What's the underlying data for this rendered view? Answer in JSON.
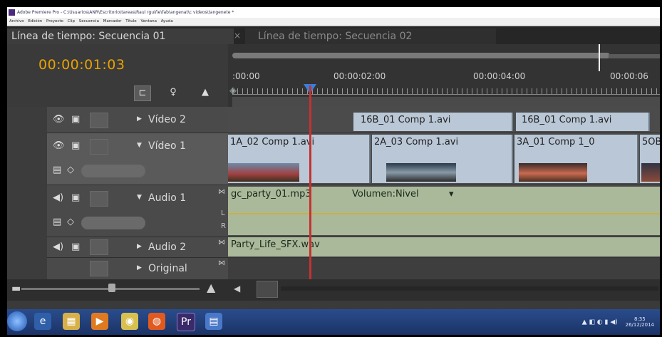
{
  "window": {
    "title": "Adobe Premiere Pro - C:\\Usuarios\\ANR\\Escritorio\\tareas\\Raul rguiñe\\fab\\angenat\\c videos\\tangenete *"
  },
  "menu": [
    "Archivo",
    "Edición",
    "Proyecto",
    "Clip",
    "Secuencia",
    "Marcador",
    "Título",
    "Ventana",
    "Ayuda"
  ],
  "tabs": {
    "active": "Línea de tiempo: Secuencia 01",
    "inactive": "Línea de tiempo: Secuencia 02",
    "close_glyph": "×"
  },
  "timeline": {
    "timecode": "00:00:01:03",
    "ruler_labels": [
      ":00:00",
      "00:00:02:00",
      "00:00:04:00",
      "00:00:06"
    ],
    "tracks": [
      {
        "name": "Vídeo 2",
        "kind": "video",
        "expanded": false
      },
      {
        "name": "Vídeo 1",
        "kind": "video",
        "expanded": true
      },
      {
        "name": "Audio 1",
        "kind": "audio",
        "expanded": true
      },
      {
        "name": "Audio 2",
        "kind": "audio",
        "expanded": false
      },
      {
        "name": "Original",
        "kind": "master",
        "expanded": false
      }
    ],
    "video2_clips": [
      "16B_01 Comp 1.avi",
      "16B_01 Comp 1.avi"
    ],
    "video1_clips": [
      "1A_02 Comp 1.avi",
      "2A_03 Comp 1.avi",
      "3A_01 Comp 1_0",
      "5OB"
    ],
    "audio1_clip": "gc_party_01.mp3",
    "audio1_volume": "Volumen:Nivel",
    "audio2_clip": "Party_Life_SFX.wav"
  },
  "icons": {
    "snap": "snap-icon",
    "marker": "marker-icon",
    "keyframe": "keyframe-icon",
    "eye": "eye-icon",
    "speaker": "speaker-icon",
    "lock": "lock-icon",
    "expand_open": "expand-triangle-open-icon",
    "expand_closed": "expand-triangle-closed-icon",
    "zoom_out": "zoom-out-icon",
    "zoom_in": "zoom-in-icon"
  },
  "colors": {
    "timecode": "#e8a300",
    "playhead": "#c83030",
    "playhead_head": "#3a7fd8",
    "video_clip": "#b9c7d6",
    "audio_clip": "#aab99a"
  },
  "taskbar": {
    "apps": [
      "start",
      "ie",
      "explorer",
      "media",
      "chrome",
      "firefox",
      "premiere",
      "folder"
    ],
    "tray_time": "8:35",
    "tray_date": "26/12/2014"
  }
}
